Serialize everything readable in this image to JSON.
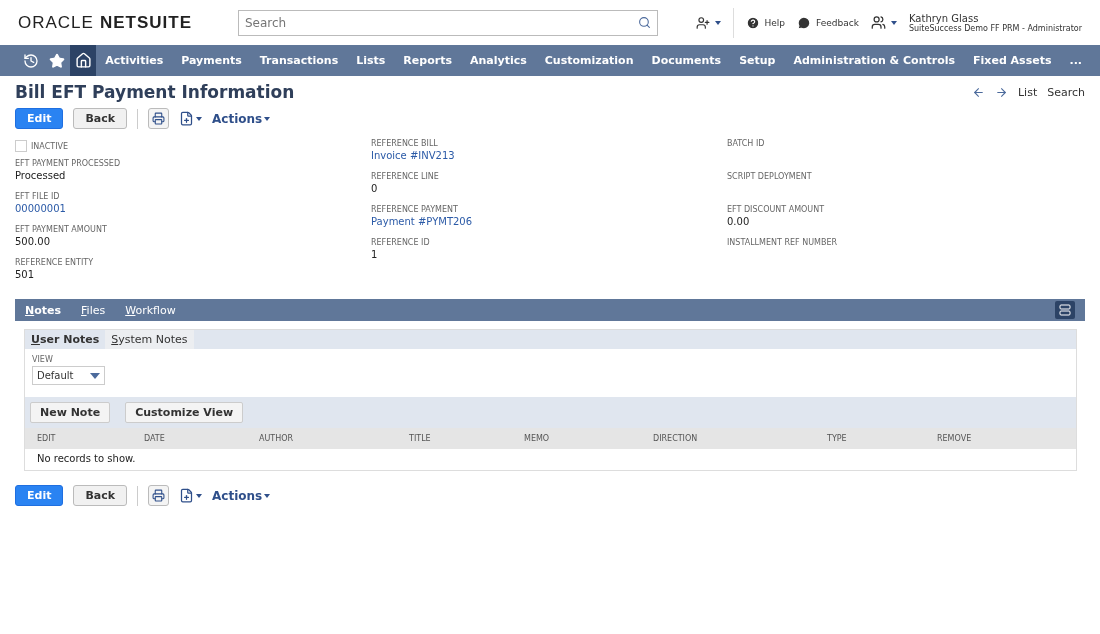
{
  "header": {
    "logo_left": "ORACLE",
    "logo_right": "NETSUITE",
    "search": {
      "placeholder": "Search"
    },
    "help": "Help",
    "feedback": "Feedback",
    "user": {
      "name": "Kathryn Glass",
      "role": "SuiteSuccess Demo FF PRM - Administrator"
    }
  },
  "nav": {
    "icons": [
      {
        "kind": "history",
        "selected": false
      },
      {
        "kind": "star",
        "selected": false
      },
      {
        "kind": "home",
        "selected": true
      }
    ],
    "items": [
      "Activities",
      "Payments",
      "Transactions",
      "Lists",
      "Reports",
      "Analytics",
      "Customization",
      "Documents",
      "Setup",
      "Administration & Controls",
      "Fixed Assets"
    ],
    "more": "..."
  },
  "page": {
    "title": "Bill EFT Payment Information",
    "pager": [
      "List",
      "Search"
    ]
  },
  "toolbar": {
    "edit": "Edit",
    "back": "Back",
    "actions": "Actions"
  },
  "fields": [
    [
      {
        "kind": "checkbox",
        "label": "INACTIVE",
        "checked": false
      },
      {
        "kind": "text",
        "label": "EFT PAYMENT PROCESSED",
        "value": "Processed"
      },
      {
        "kind": "link",
        "label": "EFT FILE ID",
        "value": "00000001"
      },
      {
        "kind": "text",
        "label": "EFT PAYMENT AMOUNT",
        "value": "500.00"
      },
      {
        "kind": "text",
        "label": "REFERENCE ENTITY",
        "value": "501"
      }
    ],
    [
      {
        "kind": "link",
        "label": "REFERENCE BILL",
        "value": "Invoice #INV213"
      },
      {
        "kind": "text",
        "label": "REFERENCE LINE",
        "value": "0"
      },
      {
        "kind": "link",
        "label": "REFERENCE PAYMENT",
        "value": "Payment #PYMT206"
      },
      {
        "kind": "text",
        "label": "REFERENCE ID",
        "value": "1"
      }
    ],
    [
      {
        "kind": "text",
        "label": "BATCH ID"
      },
      {
        "kind": "text",
        "label": "SCRIPT DEPLOYMENT"
      },
      {
        "kind": "text",
        "label": "EFT DISCOUNT AMOUNT",
        "value": "0.00"
      },
      {
        "kind": "text",
        "label": "INSTALLMENT REF NUMBER"
      }
    ]
  ],
  "tabs": [
    {
      "label": "Notes",
      "selected": true
    },
    {
      "label": "Files",
      "selected": false
    },
    {
      "label": "Workflow",
      "selected": false
    }
  ],
  "subtabs": [
    {
      "label": "User Notes",
      "selected": true
    },
    {
      "label": "System Notes",
      "selected": false
    }
  ],
  "view": {
    "label": "VIEW",
    "value": "Default"
  },
  "list_buttons": [
    "New Note",
    "Customize View"
  ],
  "table": {
    "columns": [
      "EDIT",
      "DATE",
      "AUTHOR",
      "TITLE",
      "MEMO",
      "DIRECTION",
      "TYPE",
      "REMOVE"
    ],
    "empty": "No records to show."
  },
  "bottom_toolbar": {
    "edit": "Edit",
    "back": "Back",
    "actions": "Actions"
  }
}
